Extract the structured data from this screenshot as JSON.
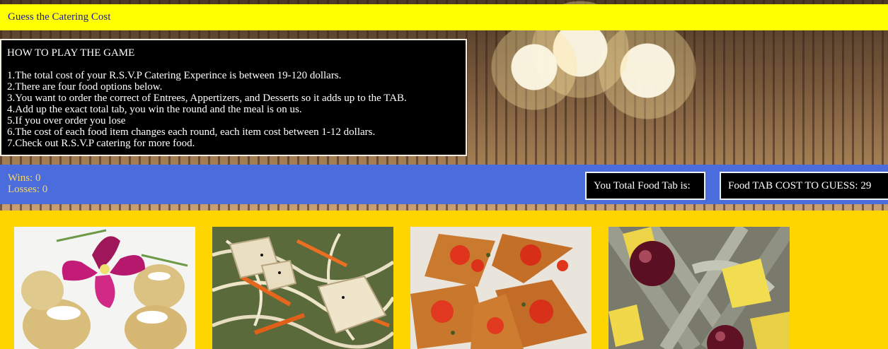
{
  "header": {
    "title": "Guess the Catering Cost"
  },
  "instructions": {
    "heading": "HOW TO PLAY THE GAME",
    "rules": [
      "1.The total cost of your R.S.V.P Catering Experince is between 19-120 dollars.",
      "2.There are four food options below.",
      "3.You want to order the correct of Entrees, Appertizers, and Desserts so it adds up to the TAB.",
      "4.Add up the exact total tab, you win the round and the meal is on us.",
      "5.If you over order you lose",
      "6.The cost of each food item changes each round, each item cost between 1-12 dollars.",
      "7.Check out R.S.V.P catering for more food."
    ]
  },
  "score": {
    "wins_label": "Wins: 0",
    "losses_label": "Losses: 0"
  },
  "tab": {
    "current_label": "You Total Food Tab is:",
    "guess_label": "Food TAB COST TO GUESS: 29"
  },
  "food_items": [
    {
      "icon": "potato-orchid-appetizer-image"
    },
    {
      "icon": "tofu-noodle-salad-image"
    },
    {
      "icon": "tomato-flatbread-image"
    },
    {
      "icon": "pineapple-fruit-dessert-image"
    }
  ],
  "colors": {
    "title_bar": "#ffff00",
    "title_text": "#1a1a9e",
    "score_bar": "#4a6cdc",
    "score_text": "#f5d76a",
    "food_area": "#ffd500",
    "panel": "#000000"
  }
}
